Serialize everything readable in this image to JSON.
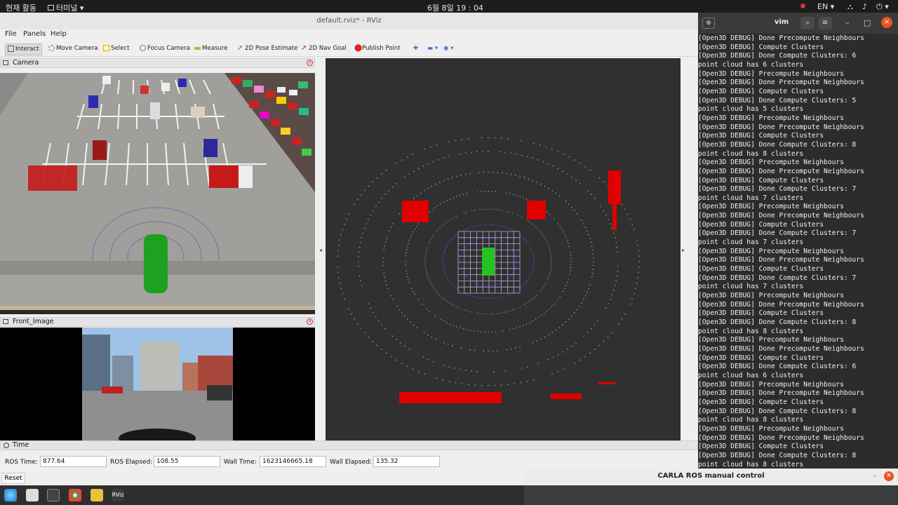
{
  "topbar": {
    "activities": "현재 활동",
    "app": "터미널",
    "clock": "6월 8일  19 : 04",
    "lang": "EN"
  },
  "rviz": {
    "title": "default.rviz* - RViz",
    "menu": [
      "File",
      "Panels",
      "Help"
    ],
    "tools": [
      "Interact",
      "Move Camera",
      "Select",
      "Focus Camera",
      "Measure",
      "2D Pose Estimate",
      "2D Nav Goal",
      "Publish Point"
    ],
    "camera_panel": "Camera",
    "front_panel": "Front_Image",
    "time_panel": {
      "title": "Time",
      "ros_time_label": "ROS Time:",
      "ros_time": "877.64",
      "ros_elapsed_label": "ROS Elapsed:",
      "ros_elapsed": "108.55",
      "wall_time_label": "Wall Time:",
      "wall_time": "1623146665.18",
      "wall_elapsed_label": "Wall Elapsed:",
      "wall_elapsed": "135.32",
      "reset": "Reset"
    }
  },
  "vim": {
    "title": "vim"
  },
  "terminal_lines": [
    "[Open3D DEBUG] Done Precompute Neighbours",
    "[Open3D DEBUG] Compute Clusters",
    "[Open3D DEBUG] Done Compute Clusters: 6",
    "point cloud has 6 clusters",
    "[Open3D DEBUG] Precompute Neighbours",
    "[Open3D DEBUG] Done Precompute Neighbours",
    "[Open3D DEBUG] Compute Clusters",
    "[Open3D DEBUG] Done Compute Clusters: 5",
    "point cloud has 5 clusters",
    "[Open3D DEBUG] Precompute Neighbours",
    "[Open3D DEBUG] Done Precompute Neighbours",
    "[Open3D DEBUG] Compute Clusters",
    "[Open3D DEBUG] Done Compute Clusters: 8",
    "point cloud has 8 clusters",
    "[Open3D DEBUG] Precompute Neighbours",
    "[Open3D DEBUG] Done Precompute Neighbours",
    "[Open3D DEBUG] Compute Clusters",
    "[Open3D DEBUG] Done Compute Clusters: 7",
    "point cloud has 7 clusters",
    "[Open3D DEBUG] Precompute Neighbours",
    "[Open3D DEBUG] Done Precompute Neighbours",
    "[Open3D DEBUG] Compute Clusters",
    "[Open3D DEBUG] Done Compute Clusters: 7",
    "point cloud has 7 clusters",
    "[Open3D DEBUG] Precompute Neighbours",
    "[Open3D DEBUG] Done Precompute Neighbours",
    "[Open3D DEBUG] Compute Clusters",
    "[Open3D DEBUG] Done Compute Clusters: 7",
    "point cloud has 7 clusters",
    "[Open3D DEBUG] Precompute Neighbours",
    "[Open3D DEBUG] Done Precompute Neighbours",
    "[Open3D DEBUG] Compute Clusters",
    "[Open3D DEBUG] Done Compute Clusters: 8",
    "point cloud has 8 clusters",
    "[Open3D DEBUG] Precompute Neighbours",
    "[Open3D DEBUG] Done Precompute Neighbours",
    "[Open3D DEBUG] Compute Clusters",
    "[Open3D DEBUG] Done Compute Clusters: 6",
    "point cloud has 6 clusters",
    "[Open3D DEBUG] Precompute Neighbours",
    "[Open3D DEBUG] Done Precompute Neighbours",
    "[Open3D DEBUG] Compute Clusters",
    "[Open3D DEBUG] Done Compute Clusters: 8",
    "point cloud has 8 clusters",
    "[Open3D DEBUG] Precompute Neighbours",
    "[Open3D DEBUG] Done Precompute Neighbours",
    "[Open3D DEBUG] Compute Clusters",
    "[Open3D DEBUG] Done Compute Clusters: 8",
    "point cloud has 8 clusters"
  ],
  "carla": {
    "title": "CARLA ROS manual control"
  },
  "colors": {
    "detection": "#e00000",
    "ego": "#22c322",
    "grid": "#b9a9d6"
  }
}
